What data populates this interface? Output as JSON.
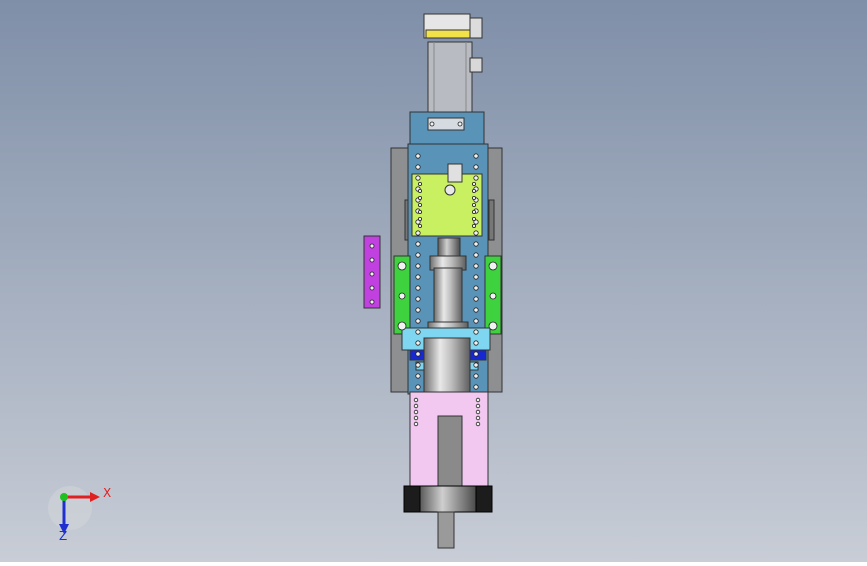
{
  "viewport": {
    "background_top": "#7f8fa8",
    "background_bottom": "#c8cdd6"
  },
  "triad": {
    "x_label": "X",
    "z_label": "Z",
    "x_color": "#e02020",
    "y_color": "#20c020",
    "z_color": "#2030d0"
  },
  "colors": {
    "motor_gray": "#b8bcc2",
    "motor_yellow": "#f2e24a",
    "plate_blue": "#5a93b8",
    "side_plate_gray": "#8d8f91",
    "carriage_lime": "#c8f060",
    "rail_green": "#3fd23f",
    "bracket_purple": "#c040e0",
    "clamp_cyan": "#7fd6f0",
    "clamp_blue": "#1828d0",
    "housing_pink": "#f2c8f0",
    "roller_black": "#1c1c1c",
    "shaft_gray": "#9a9a9a"
  }
}
